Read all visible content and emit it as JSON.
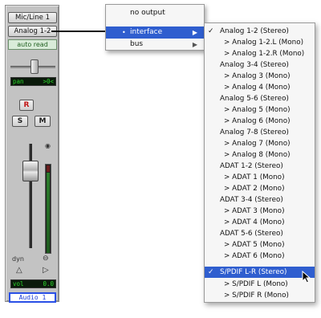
{
  "strip": {
    "input_label": "Mic/Line 1",
    "output_label": "Analog 1-2",
    "automation_label": "auto read",
    "pan_label": "pan",
    "pan_value": ">0<",
    "record_label": "R",
    "solo_label": "S",
    "mute_label": "M",
    "dyn_label": "dyn",
    "vol_label": "vol",
    "vol_value": "0.0",
    "track_name": "Audio 1"
  },
  "output_menu": {
    "items": [
      {
        "label": "no output"
      },
      {
        "label": "interface",
        "selected": true,
        "bullet": "•",
        "arrow": "▶"
      },
      {
        "label": "bus",
        "arrow": "▶"
      }
    ]
  },
  "interface_submenu": {
    "items": [
      {
        "label": "Analog 1-2 (Stereo)",
        "check": "✓"
      },
      {
        "label": "> Analog 1-2.L (Mono)"
      },
      {
        "label": "> Analog 1-2.R (Mono)"
      },
      {
        "label": "Analog 3-4 (Stereo)"
      },
      {
        "label": "> Analog 3 (Mono)"
      },
      {
        "label": "> Analog 4 (Mono)"
      },
      {
        "label": "Analog 5-6 (Stereo)"
      },
      {
        "label": "> Analog 5 (Mono)"
      },
      {
        "label": "> Analog 6 (Mono)"
      },
      {
        "label": "Analog 7-8 (Stereo)"
      },
      {
        "label": "> Analog 7 (Mono)"
      },
      {
        "label": "> Analog 8 (Mono)"
      },
      {
        "label": "ADAT 1-2 (Stereo)"
      },
      {
        "label": "> ADAT 1 (Mono)"
      },
      {
        "label": "> ADAT 2 (Mono)"
      },
      {
        "label": "ADAT 3-4 (Stereo)"
      },
      {
        "label": "> ADAT 3 (Mono)"
      },
      {
        "label": "> ADAT 4 (Mono)"
      },
      {
        "label": "ADAT 5-6 (Stereo)"
      },
      {
        "label": "> ADAT 5 (Mono)"
      },
      {
        "label": "> ADAT 6 (Mono)"
      },
      {
        "label": "S/PDIF L-R (Stereo)",
        "check": "✓",
        "selected": true
      },
      {
        "label": "> S/PDIF L (Mono)"
      },
      {
        "label": "> S/PDIF R (Mono)"
      }
    ]
  },
  "colors": {
    "menu_highlight": "#2f5ecf",
    "track_name_border": "#2a50e6",
    "readout_text": "#2bd72b",
    "record_red": "#c21818"
  }
}
